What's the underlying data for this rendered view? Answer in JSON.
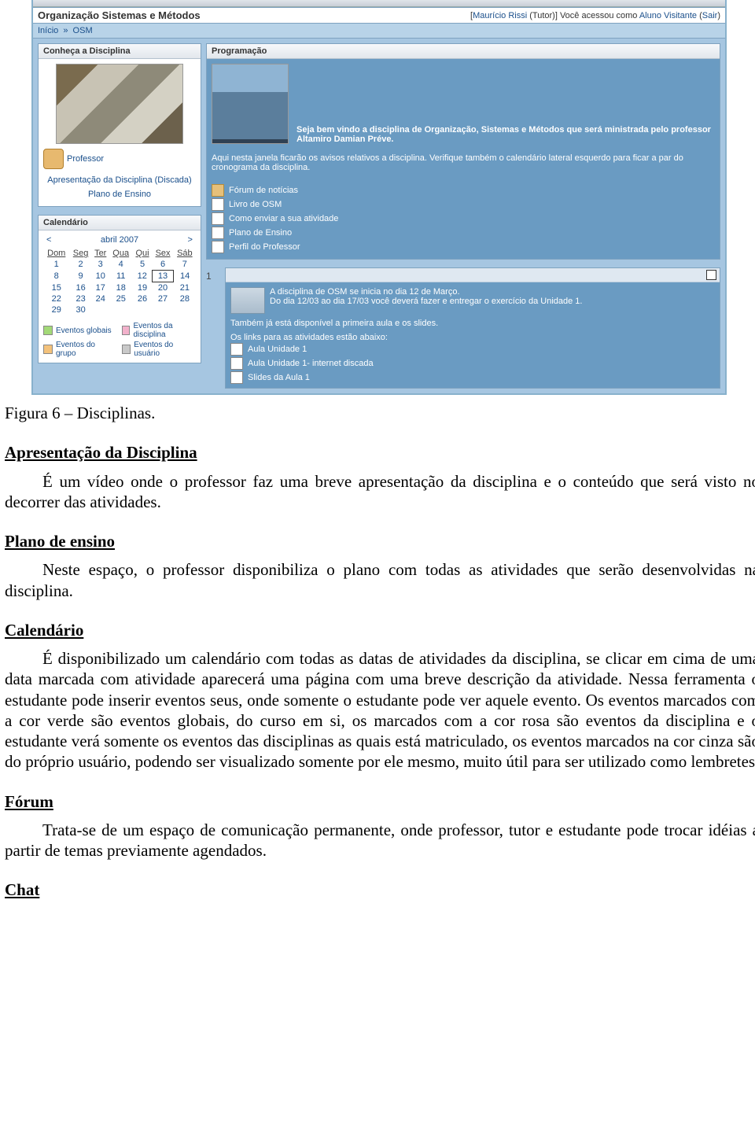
{
  "app": {
    "site_title": "Organização Sistemas e Métodos",
    "user_bar": {
      "prefix": "[",
      "tutor_name": "Maurício Rissi",
      "tutor_role": " (Tutor)",
      "middle": "] Você acessou como ",
      "visitor": "Aluno Visitante",
      "logout_open": " (",
      "logout": "Sair",
      "logout_close": ")"
    },
    "breadcrumb": {
      "home": "Início",
      "current": "OSM",
      "sep": "»"
    },
    "left_panel1": {
      "title": "Conheça a Disciplina",
      "prof_label": "Professor",
      "link1": "Apresentação da Disciplina (Discada)",
      "link2": "Plano de Ensino"
    },
    "left_panel2": {
      "title": "Calendário",
      "month": "abril 2007",
      "prev": "<",
      "next": ">",
      "days": [
        "Dom",
        "Seg",
        "Ter",
        "Qua",
        "Qui",
        "Sex",
        "Sáb"
      ],
      "weeks": [
        [
          "1",
          "2",
          "3",
          "4",
          "5",
          "6",
          "7"
        ],
        [
          "8",
          "9",
          "10",
          "11",
          "12",
          "13",
          "14"
        ],
        [
          "15",
          "16",
          "17",
          "18",
          "19",
          "20",
          "21"
        ],
        [
          "22",
          "23",
          "24",
          "25",
          "26",
          "27",
          "28"
        ],
        [
          "29",
          "30",
          "",
          "",
          "",
          "",
          ""
        ]
      ],
      "legend": {
        "global": "Eventos globais",
        "course": "Eventos da disciplina",
        "group": "Eventos do grupo",
        "user": "Eventos do usuário"
      }
    },
    "main_panel": {
      "title": "Programação",
      "welcome": "Seja bem vindo a disciplina de Organização, Sistemas e Métodos que será ministrada pelo professor Altamiro Damian Préve.",
      "notice": "Aqui nesta janela ficarão os avisos relativos a disciplina. Verifique também o calendário lateral esquerdo para ficar a par do cronograma da disciplina.",
      "resources": [
        "Fórum de notícias",
        "Livro de OSM",
        "Como enviar a sua atividade",
        "Plano de Ensino",
        "Perfil do Professor"
      ],
      "topic1": {
        "num": "1",
        "l1": "A disciplina de OSM se inicia no dia 12 de Março.",
        "l2": "Do dia 12/03 ao dia 17/03 você deverá fazer e entregar o exercício da Unidade 1.",
        "l3": "Também já está disponível a primeira aula e os slides.",
        "l4": "Os links para as atividades estão abaixo:",
        "links": [
          "Aula Unidade 1",
          "Aula Unidade 1- internet discada",
          "Slides da Aula 1"
        ]
      }
    }
  },
  "doc": {
    "caption": "Figura 6 – Disciplinas.",
    "h1": "Apresentação da Disciplina",
    "p1": "É um vídeo onde o professor faz uma breve apresentação da disciplina e o conteúdo que será visto no decorrer das atividades.",
    "h2": "Plano de ensino",
    "p2": "Neste espaço, o professor disponibiliza o plano com todas as atividades que serão desenvolvidas na disciplina.",
    "h3": "Calendário",
    "p3": "É disponibilizado um calendário com todas as datas de atividades da disciplina, se clicar em cima de uma data marcada com atividade aparecerá uma página com uma breve descrição da atividade. Nessa ferramenta o estudante pode inserir eventos seus, onde somente o estudante pode ver aquele evento. Os eventos marcados com a cor verde são eventos globais, do curso em si, os marcados com a cor rosa são eventos da disciplina e o estudante verá somente os eventos das disciplinas as quais está matriculado, os eventos marcados na cor cinza são do próprio usuário, podendo ser visualizado somente por ele mesmo, muito útil para ser utilizado como lembretes.",
    "h4": "Fórum",
    "p4": "Trata-se de um espaço de comunicação permanente, onde professor, tutor e estudante pode trocar idéias a partir de temas previamente agendados.",
    "h5": "Chat"
  }
}
